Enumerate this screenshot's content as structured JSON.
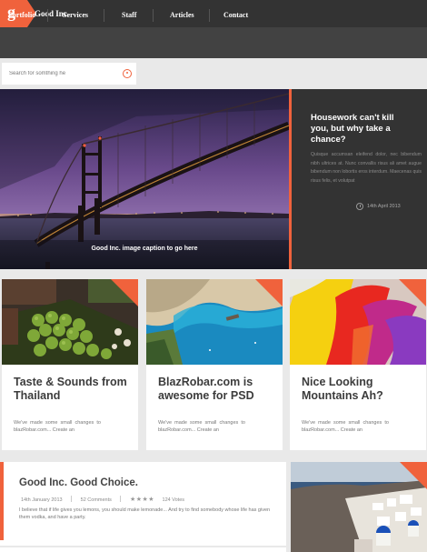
{
  "header": {
    "logo_letter": "g",
    "brand": "Good Inc."
  },
  "nav": {
    "items": [
      "Portfolio",
      "Services",
      "Staff",
      "Articles",
      "Contact"
    ]
  },
  "search": {
    "placeholder": "Search for somthing he"
  },
  "hero": {
    "caption": "Good Inc. image caption to go here",
    "side_title": "Housework can't kill you, but why take a chance?",
    "side_body": "Quisque accumsan eleifend dolor, nec bibendum nibh ultrices at. Nunc convallis risus ali amet augue bibendum non lobortis eros interdum. Maecenas quis risus felis, et volutpat",
    "date": "14th April 2013"
  },
  "cards": [
    {
      "title": "Taste & Sounds from Thailand",
      "text": "We've made some small changes to blazRobar.com... Create an"
    },
    {
      "title": "BlazRobar.com is awesome for PSD",
      "text": "We've made some small changes to blazRobar.com... Create an"
    },
    {
      "title": "Nice Looking Mountains Ah?",
      "text": "We've made some small changes to blazRobar.com... Create an"
    }
  ],
  "article": {
    "title": "Good Inc. Good Choice.",
    "date": "14th January 2013",
    "comments": "52 Comments",
    "votes": "124 Votes",
    "rating": 4,
    "text": "I believe that if life gives you lemons, you should make lemonade... And try to find somebody whose life has given them vodka, and have a party."
  },
  "colors": {
    "accent": "#f0623c",
    "dark": "#333333",
    "nav": "#424242"
  }
}
